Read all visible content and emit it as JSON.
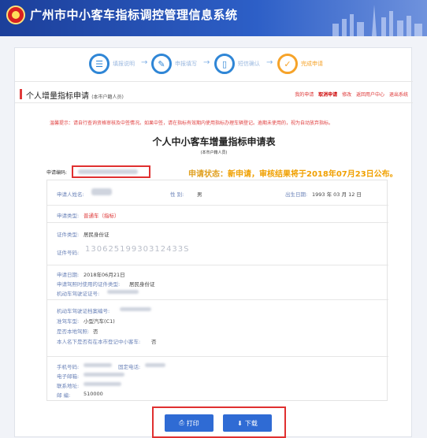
{
  "header": {
    "title": "广州市中小客车指标调控管理信息系统"
  },
  "steps": [
    {
      "label": "填报说明",
      "icon": "list-icon"
    },
    {
      "label": "申报填写",
      "icon": "edit-icon"
    },
    {
      "label": "短信确认",
      "icon": "phone-icon"
    },
    {
      "label": "完成申请",
      "icon": "done-icon"
    }
  ],
  "page": {
    "title": "个人增量指标申请",
    "title_sub": "(本市户籍人员)",
    "links": [
      "我的申请",
      "取消申请",
      "修改",
      "返回用户中心",
      "退出系统"
    ]
  },
  "notice": "温馨提示：请自行查询资格审核及中签情况。如果中签，请在指标有效期内使用指标办理车辆登记。逾期未使用的，视为自动放弃指标。",
  "form": {
    "title": "个人中小客车增量指标申请表",
    "subtitle": "(本市户籍人员)",
    "apply_no_label": "申请编码:",
    "status_label": "申请状态：",
    "status_value": "新申请，审核结果将于2018年07月23日公布。",
    "applicant_label": "申请人姓名:",
    "gender_label": "性    别:",
    "gender_value": "男",
    "birth_label": "出生日期:",
    "birth_value": "1993 年 03 月 12 日",
    "type_label": "申请类型:",
    "type_value": "普通车（指标）",
    "id_type_label": "证件类型:",
    "id_type_value": "居民身份证",
    "id_no_label": "证件号码:",
    "id_no_value": "13062519930312433S",
    "apply_date_label": "申请日期:",
    "apply_date_value": "2018年06月21日",
    "license_id_type_label": "申请驾照时使用的证件类型:",
    "license_id_type_value": "居民身份证",
    "license_no_label": "机动车驾驶证证号:",
    "license_file_label": "机动车驾驶证档案编号:",
    "vehicle_class_label": "准驾车型:",
    "vehicle_class_value": "小型汽车(C1)",
    "local_license_label": "是否本地驾照:",
    "local_license_value": "否",
    "registered_label": "本人名下是否有在本市登记中小客车:",
    "registered_value": "否",
    "mobile_label": "手机号码:",
    "phone_label": "固定电话:",
    "email_label": "电子邮箱:",
    "address_label": "联系地址:",
    "postcode_label": "邮    编:",
    "postcode_value": "510000"
  },
  "buttons": {
    "print": "打印",
    "download": "下载"
  }
}
